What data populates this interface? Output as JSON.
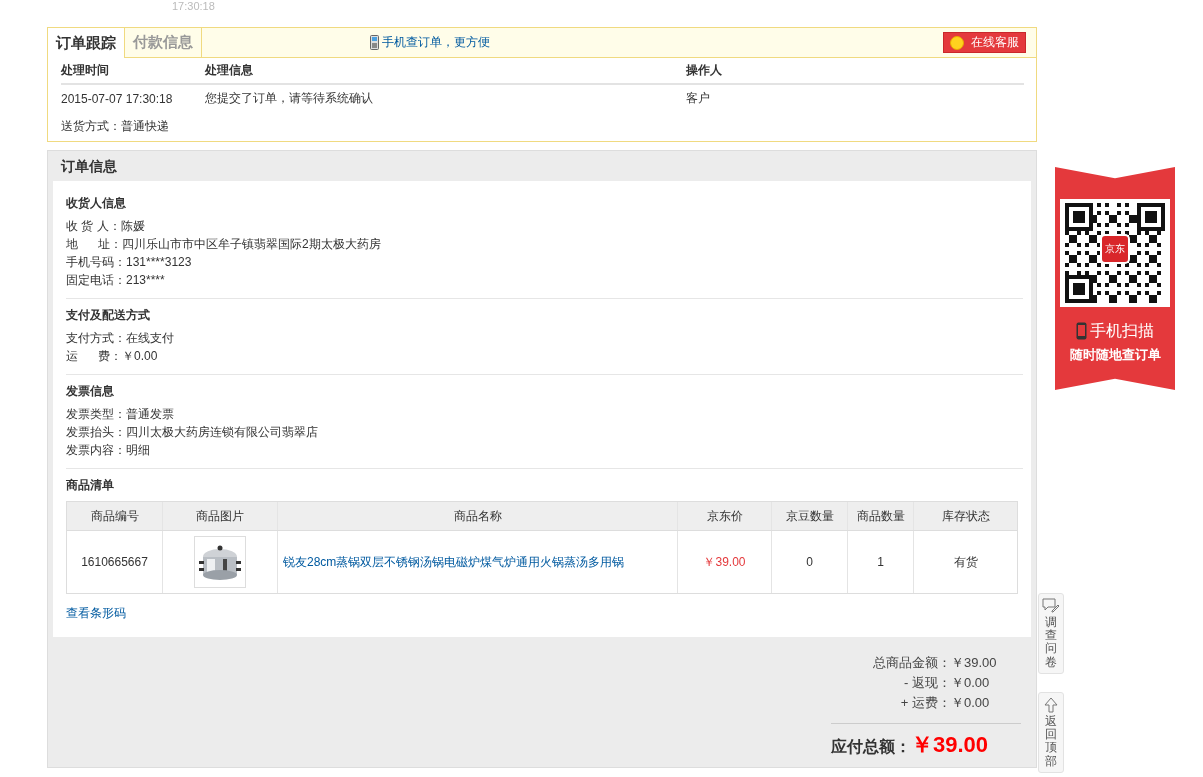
{
  "timestamp": "17:30:18",
  "tracking": {
    "tabs": [
      {
        "label": "订单跟踪",
        "selected": true
      },
      {
        "label": "付款信息",
        "selected": false
      }
    ],
    "mobile_link": "手机查订单，更方便",
    "service_button": "在线客服",
    "columns": [
      "处理时间",
      "处理信息",
      "操作人"
    ],
    "rows": [
      [
        "2015-07-07 17:30:18",
        "您提交了订单，请等待系统确认",
        "客户"
      ]
    ],
    "delivery": "送货方式：普通快递"
  },
  "order_info": {
    "title": "订单信息",
    "sections": [
      {
        "title": "收货人信息",
        "lines": [
          {
            "label": "收 货 人：",
            "value": "陈媛"
          },
          {
            "label": "地      址：",
            "value": "四川乐山市市中区牟子镇翡翠国际2期太极大药房"
          },
          {
            "label": "手机号码：",
            "value": "131****3123"
          },
          {
            "label": "固定电话：",
            "value": "213****"
          }
        ]
      },
      {
        "title": "支付及配送方式",
        "lines": [
          {
            "label": "支付方式：",
            "value": "在线支付"
          },
          {
            "label": "运      费：",
            "value": "￥0.00"
          }
        ]
      },
      {
        "title": "发票信息",
        "lines": [
          {
            "label": "发票类型：",
            "value": "普通发票"
          },
          {
            "label": "发票抬头：",
            "value": "四川太极大药房连锁有限公司翡翠店"
          },
          {
            "label": "发票内容：",
            "value": "明细"
          }
        ]
      }
    ],
    "products": {
      "title": "商品清单",
      "columns": [
        "商品编号",
        "商品图片",
        "商品名称",
        "京东价",
        "京豆数量",
        "商品数量",
        "库存状态"
      ],
      "rows": [
        {
          "id": "1610665667",
          "name": "锐友28cm蒸锅双层不锈钢汤锅电磁炉煤气炉通用火锅蒸汤多用锅",
          "price": "￥39.00",
          "beans": "0",
          "quantity": "1",
          "stock": "有货"
        }
      ]
    },
    "barcode_link": "查看条形码",
    "totals": [
      {
        "label": "总商品金额：",
        "value": "￥39.00"
      },
      {
        "label": "- 返现：",
        "value": "￥0.00"
      },
      {
        "label": "+ 运费：",
        "value": "￥0.00"
      }
    ],
    "payable": {
      "label": "应付总额：",
      "value": "￥39.00"
    }
  },
  "promo": {
    "qr_badge": "京东",
    "lines": [
      "手机扫描",
      "随时随地查订单"
    ]
  },
  "side_buttons": [
    {
      "kind": "survey",
      "label": "调查问卷"
    },
    {
      "kind": "top",
      "label": "返回顶部"
    }
  ]
}
